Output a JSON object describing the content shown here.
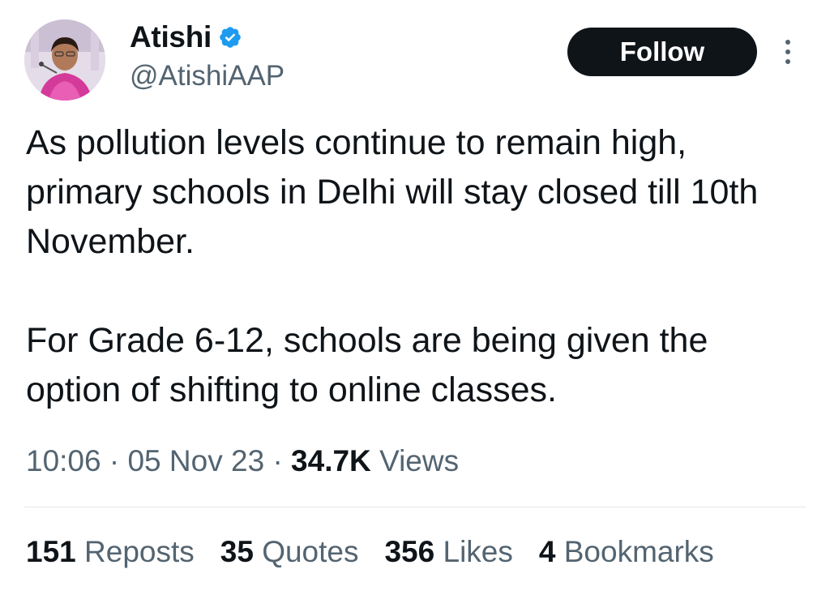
{
  "author": {
    "display_name": "Atishi",
    "handle": "@AtishiAAP",
    "verified_icon": "verified-badge-icon",
    "avatar_icon": "profile-photo"
  },
  "header": {
    "follow_label": "Follow",
    "more_icon": "more-vertical-icon"
  },
  "tweet": {
    "paragraphs": [
      "As pollution levels continue to remain high, primary schools in Delhi will stay closed till 10th November.",
      "For Grade 6-12, schools are being given the option of shifting to online classes."
    ],
    "time": "10:06",
    "date": "05 Nov 23",
    "separator": "·",
    "views_count": "34.7K",
    "views_label": "Views"
  },
  "stats": [
    {
      "count": "151",
      "label": "Reposts"
    },
    {
      "count": "35",
      "label": "Quotes"
    },
    {
      "count": "356",
      "label": "Likes"
    },
    {
      "count": "4",
      "label": "Bookmarks"
    }
  ],
  "colors": {
    "text_primary": "#0f1419",
    "text_secondary": "#536471",
    "verified_blue": "#1d9bf0",
    "button_bg": "#0f1419",
    "divider": "#e3e7ea"
  }
}
